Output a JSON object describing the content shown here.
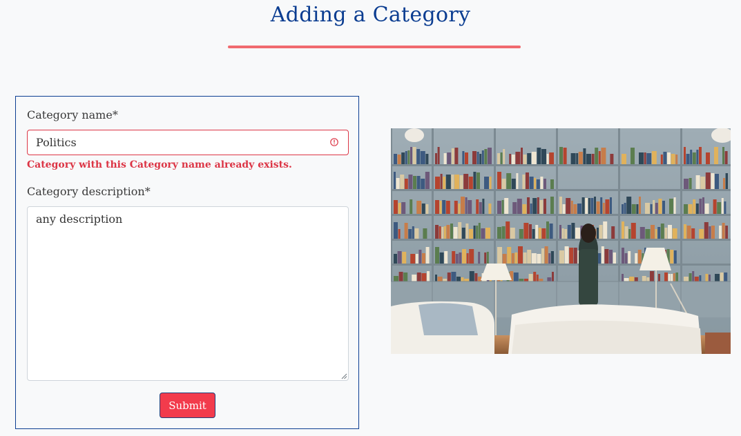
{
  "page": {
    "title": "Adding a Category",
    "accent_color": "#f06a6f",
    "title_color": "#0b3d91"
  },
  "form": {
    "name_label": "Category name*",
    "name_value": "Politics",
    "name_error": "Category with this Category name already exists.",
    "description_label": "Category description*",
    "description_value": "any description",
    "submit_label": "Submit",
    "error_color": "#dc3545",
    "button_color": "#f23b4c"
  },
  "image": {
    "subject": "library-bookshelves-photo"
  }
}
